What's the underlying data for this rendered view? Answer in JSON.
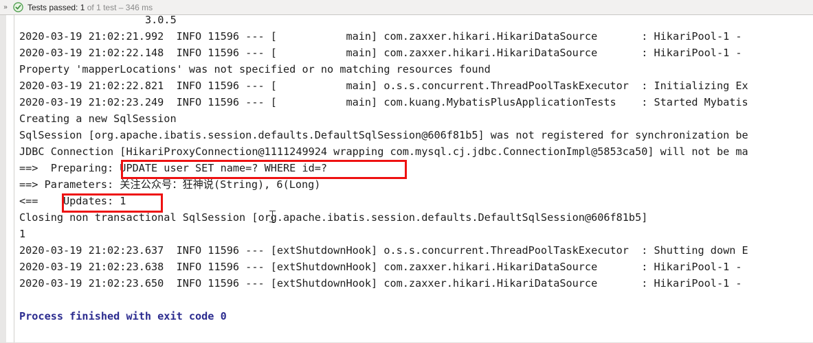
{
  "test_status_bar": {
    "expand_icon": "expand-chevron-icon",
    "result_icon": "test-passed-green-check-icon",
    "label": "Tests passed:",
    "count": "1",
    "of_text": " of 1 test ",
    "separator": "–",
    "duration": " 346 ms"
  },
  "console": {
    "banner_version": "3.0.5",
    "lines": [
      "2020-03-19 21:02:21.992  INFO 11596 --- [           main] com.zaxxer.hikari.HikariDataSource       : HikariPool-1 -",
      "2020-03-19 21:02:22.148  INFO 11596 --- [           main] com.zaxxer.hikari.HikariDataSource       : HikariPool-1 -",
      "Property 'mapperLocations' was not specified or no matching resources found",
      "2020-03-19 21:02:22.821  INFO 11596 --- [           main] o.s.s.concurrent.ThreadPoolTaskExecutor  : Initializing Ex",
      "2020-03-19 21:02:23.249  INFO 11596 --- [           main] com.kuang.MybatisPlusApplicationTests    : Started Mybatis",
      "Creating a new SqlSession",
      "SqlSession [org.apache.ibatis.session.defaults.DefaultSqlSession@606f81b5] was not registered for synchronization be",
      "JDBC Connection [HikariProxyConnection@1111249924 wrapping com.mysql.cj.jdbc.ConnectionImpl@5853ca50] will not be ma",
      "==>  Preparing: UPDATE user SET name=? WHERE id=?",
      "==> Parameters: 关注公众号：狂神说(String), 6(Long)",
      "<==    Updates: 1",
      "Closing non transactional SqlSession [org.apache.ibatis.session.defaults.DefaultSqlSession@606f81b5]",
      "1",
      "2020-03-19 21:02:23.637  INFO 11596 --- [extShutdownHook] o.s.s.concurrent.ThreadPoolTaskExecutor  : Shutting down E",
      "2020-03-19 21:02:23.638  INFO 11596 --- [extShutdownHook] com.zaxxer.hikari.HikariDataSource       : HikariPool-1 -",
      "2020-03-19 21:02:23.650  INFO 11596 --- [extShutdownHook] com.zaxxer.hikari.HikariDataSource       : HikariPool-1 -"
    ],
    "exit_line": "Process finished with exit code 0"
  },
  "annotations": {
    "sql_box_label": "UPDATE user SET name=? WHERE id=?",
    "updates_box_label": "Updates: 1",
    "color": "#ee1111"
  },
  "colors": {
    "status_bar_bg": "#f2f1f0",
    "console_bg": "#ffffff",
    "text": "#1d1d1d",
    "exit_code_text": "#2b2b8f",
    "pass_green": "#59a869",
    "annotation_red": "#ee1111"
  }
}
